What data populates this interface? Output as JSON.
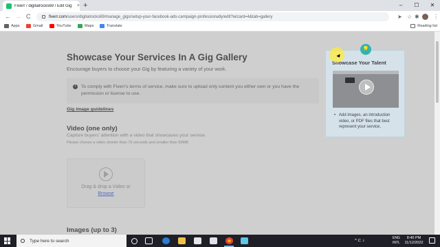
{
  "browser": {
    "tab_title": "Fiverr / digitalrocks69 / Edit Gig",
    "tab_close": "×",
    "new_tab": "+",
    "minimize": "–",
    "maximize": "☐",
    "close": "✕",
    "back": "←",
    "forward": "→",
    "reload": "C",
    "url_host": "fiverr.com",
    "url_path": "/users/digitalrocks69/manage_gigs/setup-your-facebook-ads-campaign-professionally/edit?wizard=4&tab=gallery",
    "bookmarks": [
      {
        "label": "Apps",
        "icon": "apps-grid-icon",
        "color": "#5f6368"
      },
      {
        "label": "Gmail",
        "icon": "gmail-icon",
        "color": "#ea4335"
      },
      {
        "label": "YouTube",
        "icon": "youtube-icon",
        "color": "#ff0000"
      },
      {
        "label": "Maps",
        "icon": "maps-icon",
        "color": "#34a853"
      },
      {
        "label": "Translate",
        "icon": "translate-icon",
        "color": "#4285f4"
      }
    ],
    "reading_list": "Reading list"
  },
  "page": {
    "title": "Showcase Your Services In A Gig Gallery",
    "subtitle": "Encourage buyers to choose your Gig by featuring a variety of your work.",
    "notice_line1": "To comply with Fiverr's terms of service, make sure to upload only content you either own or you have the",
    "notice_line2": "permission or license to use.",
    "guidelines_link": "Gig image guidelines",
    "video_heading": "Video (one only)",
    "video_desc": "Capture buyers' attention with a video that showcases your service.",
    "video_limit": "Please choose a video shorter than 75 seconds and smaller than 50MB",
    "drop_text": "Drag & drop a Video or",
    "browse": "Browse",
    "images_heading": "Images (up to 3)"
  },
  "popup": {
    "title": "Showcase Your Talent",
    "bullet": "Add images, an introduction video, or PDF files that best represent your service."
  },
  "taskbar": {
    "search_placeholder": "Type here to search",
    "lang_line1": "ENG",
    "lang_line2": "INTL",
    "time": "8:40 PM",
    "date": "11/12/2022",
    "tray_icons": "^ ⊏ ♪"
  },
  "colors": {
    "fiverr_green": "#1dbf73",
    "link_blue": "#446ee7",
    "popup_bg": "#d5e2ea",
    "bulb_teal": "#34b3b0"
  }
}
